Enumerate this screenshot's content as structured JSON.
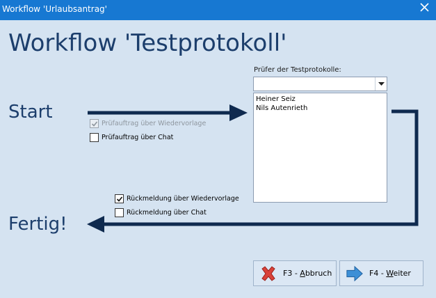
{
  "window": {
    "title": "Workflow 'Urlaubsantrag'",
    "colors": {
      "titlebar": "#1778d2",
      "background": "#d5e3f1",
      "accent": "#1c3e6c",
      "arrow": "#0f2a4f"
    }
  },
  "heading": "Workflow 'Testprotokoll'",
  "labels": {
    "start": "Start",
    "done": "Fertig!"
  },
  "reviewer": {
    "label": "Prüfer der Testprotokolle:",
    "combo_value": "",
    "list": [
      "Heiner Seiz",
      "Nils Autenrieth"
    ]
  },
  "checkboxes": {
    "order_resubmission": {
      "label": "Prüfauftrag über Wiedervorlage",
      "checked": true,
      "disabled": true
    },
    "order_chat": {
      "label": "Prüfauftrag über Chat",
      "checked": false
    },
    "feedback_resubmission": {
      "label": "Rückmeldung über Wiedervorlage",
      "checked": true
    },
    "feedback_chat": {
      "label": "Rückmeldung über Chat",
      "checked": false
    }
  },
  "buttons": {
    "cancel": {
      "key": "F3 - ",
      "mnemonic": "A",
      "rest": "bbruch",
      "icon": "red-x-icon"
    },
    "next": {
      "key": "F4 - ",
      "mnemonic": "W",
      "rest": "eiter",
      "icon": "blue-arrow-right-icon"
    }
  }
}
